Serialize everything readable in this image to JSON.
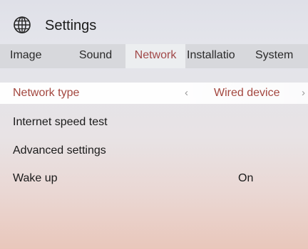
{
  "header": {
    "title": "Settings",
    "icon": "globe-icon"
  },
  "tabs": [
    {
      "label": "Image",
      "active": false
    },
    {
      "label": "Sound",
      "active": false
    },
    {
      "label": "Network",
      "active": true
    },
    {
      "label": "Installatio",
      "active": false
    },
    {
      "label": "System",
      "active": false
    }
  ],
  "menu": {
    "network_type": {
      "label": "Network type",
      "value": "Wired device",
      "left_arrow": "‹",
      "right_arrow": "›"
    },
    "speed_test": {
      "label": "Internet speed test"
    },
    "advanced": {
      "label": "Advanced settings"
    },
    "wake_up": {
      "label": "Wake up",
      "value": "On"
    }
  },
  "colors": {
    "accent": "#a3473f",
    "tab_bar": "#d7d8dc",
    "active_tab": "#eceef0"
  }
}
